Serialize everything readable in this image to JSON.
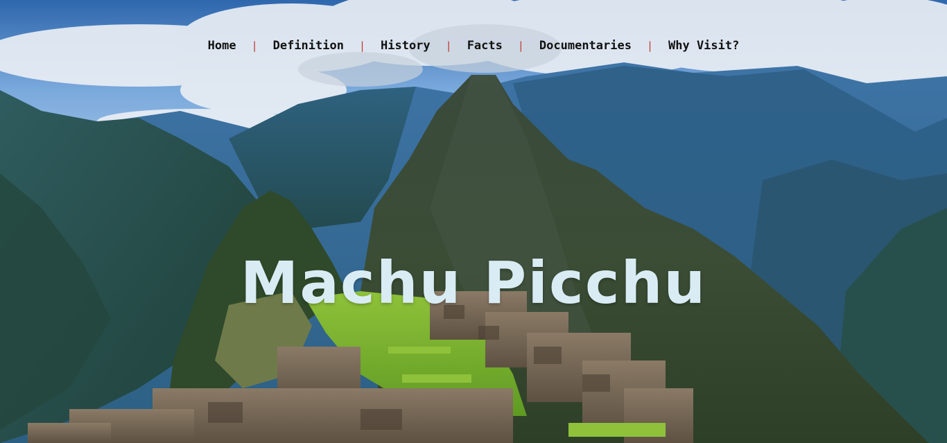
{
  "nav": {
    "items": [
      {
        "label": "Home"
      },
      {
        "label": "Definition"
      },
      {
        "label": "History"
      },
      {
        "label": "Facts"
      },
      {
        "label": "Documentaries"
      },
      {
        "label": "Why Visit?"
      }
    ],
    "separator": "|"
  },
  "hero": {
    "title": "Machu Picchu",
    "image": "mountain-ruins-landscape"
  },
  "colors": {
    "title": "#d9ecf4",
    "nav_text": "#111111",
    "separator": "#c0392b"
  }
}
